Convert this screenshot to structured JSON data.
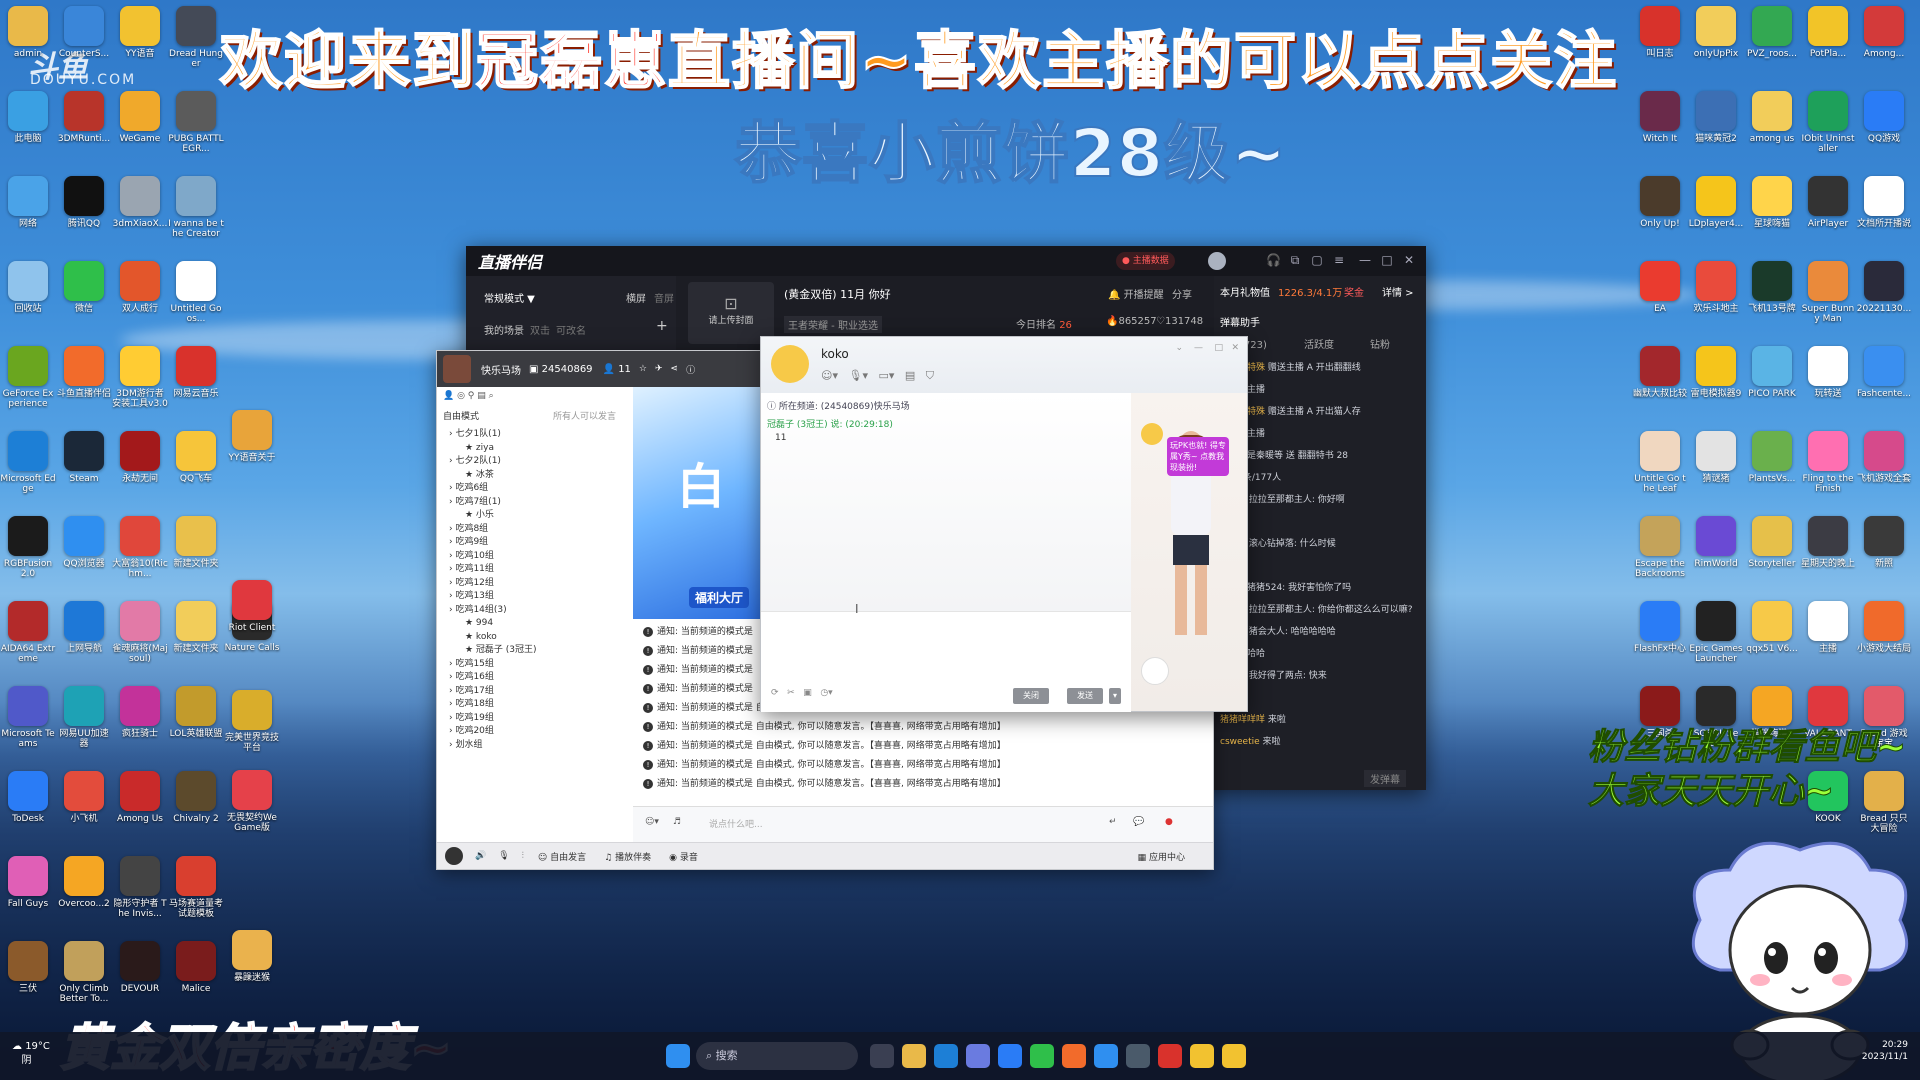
{
  "overlay": {
    "banner_welcome_a": "欢迎来到",
    "banner_welcome_name": "冠磊崽",
    "banner_welcome_b": "直播间~喜欢主播的可以点点关注",
    "banner_congrats": "恭喜小煎饼28级~",
    "banner_gold": "黄金双倍亲密度~",
    "banner_fans_1": "粉丝钻粉群看鱼吧~",
    "banner_fans_2": "大家天天开心~",
    "douyu_logo": "斗鱼",
    "douyu_sub": "DOUYU.COM"
  },
  "desktop_left": [
    {
      "label": "admin",
      "color": "#e9b949"
    },
    {
      "label": "CounterS...",
      "color": "#3a86d9"
    },
    {
      "label": "YY语音",
      "color": "#f2c230"
    },
    {
      "label": "Dread Hunger",
      "color": "#444a57"
    },
    {
      "label": "此电脑",
      "color": "#3aa0e3"
    },
    {
      "label": "3DMRunti...",
      "color": "#b8342a"
    },
    {
      "label": "WeGame",
      "color": "#f0a92b"
    },
    {
      "label": "PUBG BATTLEGR...",
      "color": "#5b5b5b"
    },
    {
      "label": "网络",
      "color": "#4aa3e8"
    },
    {
      "label": "腾讯QQ",
      "color": "#111111"
    },
    {
      "label": "3dmXiaoX...",
      "color": "#9aa5b1"
    },
    {
      "label": "I wanna be the Creator",
      "color": "#7fa8c9"
    },
    {
      "label": "回收站",
      "color": "#8fc3ec"
    },
    {
      "label": "微信",
      "color": "#2fbf4a"
    },
    {
      "label": "双人成行",
      "color": "#e3562b"
    },
    {
      "label": "Untitled Goos...",
      "color": "#ffffff"
    },
    {
      "label": "GeForce Experience",
      "color": "#6aa61f"
    },
    {
      "label": "斗鱼直播伴侣",
      "color": "#f26b2b"
    },
    {
      "label": "3DM游行者安装工具v3.0",
      "color": "#ffcc33"
    },
    {
      "label": "网易云音乐",
      "color": "#d9322c"
    },
    {
      "label": "Microsoft Edge",
      "color": "#1d7fd6"
    },
    {
      "label": "Steam",
      "color": "#1b2838"
    },
    {
      "label": "永劫无间",
      "color": "#a3191b"
    },
    {
      "label": "QQ飞车",
      "color": "#f6c53a"
    },
    {
      "label": "RGBFusion 2.0",
      "color": "#1b1b1b"
    },
    {
      "label": "QQ浏览器",
      "color": "#2f8ff0"
    },
    {
      "label": "大富翁10(Richm...",
      "color": "#e0473b"
    },
    {
      "label": "新建文件夹",
      "color": "#e9c04b"
    },
    {
      "label": "AIDA64 Extreme",
      "color": "#b32a2a"
    },
    {
      "label": "上网导航",
      "color": "#1e78d7"
    },
    {
      "label": "雀魂麻将(Majsoul)",
      "color": "#e27aa7"
    },
    {
      "label": "新建文件夹",
      "color": "#f2cd5a"
    },
    {
      "label": "Microsoft Teams",
      "color": "#5059c9"
    },
    {
      "label": "网易UU加速器",
      "color": "#1ea2b5"
    },
    {
      "label": "疯狂骑士",
      "color": "#c3329a"
    },
    {
      "label": "LOL英雄联盟",
      "color": "#c29b2c"
    },
    {
      "label": "ToDesk",
      "color": "#2a7cf6"
    },
    {
      "label": "小飞机",
      "color": "#e34c3c"
    },
    {
      "label": "Among Us",
      "color": "#c92a2a"
    },
    {
      "label": "Chivalry 2",
      "color": "#5c4a2c"
    },
    {
      "label": "Fall Guys",
      "color": "#e05fb6"
    },
    {
      "label": "Overcoo...2",
      "color": "#f5a623"
    },
    {
      "label": "隐形守护者 The Invis...",
      "color": "#444444"
    },
    {
      "label": "马场赛道量考试题模板",
      "color": "#d93f2f"
    },
    {
      "label": "三伏",
      "color": "#8b5a2b"
    },
    {
      "label": "Only Climb Better To...",
      "color": "#c1a05b"
    },
    {
      "label": "DEVOUR",
      "color": "#2a1a1a"
    },
    {
      "label": "Malice",
      "color": "#7a1c1c"
    }
  ],
  "desktop_left_extra": [
    {
      "label": "无畏契约WeGame版",
      "color": "#e5414a"
    },
    {
      "label": "完美世界竞技平台",
      "color": "#d9ad2b"
    },
    {
      "label": "Nature Calls",
      "color": "#2a2a2a"
    },
    {
      "label": "YY语音关于",
      "color": "#e8a43a"
    },
    {
      "label": "暴躁迷猴",
      "color": "#eab24d"
    },
    {
      "label": "Riot Client",
      "color": "#e0383e"
    }
  ],
  "desktop_right": [
    {
      "label": "Among...",
      "color": "#d33a3a"
    },
    {
      "label": "PotPla...",
      "color": "#f2c428"
    },
    {
      "label": "PVZ_roos...",
      "color": "#33a852"
    },
    {
      "label": "onlyUpPix",
      "color": "#f2cd5a"
    },
    {
      "label": "叫日志",
      "color": "#d8322b"
    },
    {
      "label": "QQ游戏",
      "color": "#2a7cf6"
    },
    {
      "label": "IObit Uninstaller",
      "color": "#1ea05a"
    },
    {
      "label": "among us",
      "color": "#f2cd5a"
    },
    {
      "label": "猫咪黄冠2",
      "color": "#3c6fb4"
    },
    {
      "label": "Witch It",
      "color": "#6a2a4a"
    },
    {
      "label": "文档所开播说",
      "color": "#ffffff"
    },
    {
      "label": "AirPlayer",
      "color": "#333333"
    },
    {
      "label": "星球嗨猫",
      "color": "#ffd44a"
    },
    {
      "label": "LDplayer4...",
      "color": "#f5c51b"
    },
    {
      "label": "Only Up!",
      "color": "#4b3b2b"
    },
    {
      "label": "20221130...",
      "color": "#2a2a3a"
    },
    {
      "label": "Super Bunny Man",
      "color": "#ea8a3b"
    },
    {
      "label": "飞机13号牌",
      "color": "#1a3a2a"
    },
    {
      "label": "欢乐斗地主",
      "color": "#e94b3c"
    },
    {
      "label": "EA",
      "color": "#ea3b2f"
    },
    {
      "label": "Fashcente...",
      "color": "#3a8ff0"
    },
    {
      "label": "玩转送",
      "color": "#ffffff"
    },
    {
      "label": "PICO PARK",
      "color": "#5ab4e5"
    },
    {
      "label": "雷电模拟器9",
      "color": "#f5c51b"
    },
    {
      "label": "幽默大叔比较",
      "color": "#a3272c"
    },
    {
      "label": "飞机游戏全套",
      "color": "#d64a8b"
    },
    {
      "label": "Fling to the Finish",
      "color": "#ff6fb1"
    },
    {
      "label": "PlantsVs...",
      "color": "#6ab04c"
    },
    {
      "label": "猜谜猪",
      "color": "#e3e3e3"
    },
    {
      "label": "Untitle Go the Leaf",
      "color": "#f0d7c0"
    },
    {
      "label": "新照",
      "color": "#3a3a3a"
    },
    {
      "label": "星期天的晚上",
      "color": "#3c3c44"
    },
    {
      "label": "Storyteller",
      "color": "#e6c04a"
    },
    {
      "label": "RimWorld",
      "color": "#6a4ad4"
    },
    {
      "label": "Escape the Backrooms",
      "color": "#c4a35a"
    },
    {
      "label": "小游戏大结局",
      "color": "#f06a2b"
    },
    {
      "label": "主播",
      "color": "#ffffff"
    },
    {
      "label": "qqx51 V6...",
      "color": "#f7c948"
    },
    {
      "label": "Epic Games Launcher",
      "color": "#222222"
    },
    {
      "label": "FlashFx中心",
      "color": "#2a7cf6"
    },
    {
      "label": "Bread 游戏宝宝",
      "color": "#e35a6a"
    },
    {
      "label": "VALORANT",
      "color": "#e0383e"
    },
    {
      "label": "猫咪嗨猫2",
      "color": "#f5a623"
    },
    {
      "label": "SGSOL Set...",
      "color": "#2a2a2a"
    },
    {
      "label": "三国杀",
      "color": "#8b1a1a"
    },
    {
      "label": "Bread 只只大冒险",
      "color": "#e3b04a"
    },
    {
      "label": "KOOK",
      "color": "#22c55e"
    }
  ],
  "live_companion": {
    "logo": "直播伴侣",
    "live_data_btn": "主播数据",
    "mode_label": "常规模式 ▼",
    "tab_switch": "横屏",
    "tab_audio": "音屏",
    "scene_label": "我的场景",
    "scene_a": "双击",
    "scene_b": "可改名",
    "add_icon": "+",
    "upload_cover": "请上传封面",
    "room_title": "(黄金双倍) 11月 你好",
    "room_tag": "王者荣耀 - 职业选选",
    "start_remind": "开播提醒",
    "share": "分享",
    "today_rank_label": "今日排名",
    "today_rank": "26",
    "hot": "865257",
    "followers": "131748",
    "month_gift_label": "本月礼物值",
    "month_gift_value": "1226.3/4.1万",
    "prize_label": "奖金",
    "details": "详情 >",
    "assistant": "弹幕助手",
    "user_count": "用户(723)",
    "tab_activity": "活跃度",
    "tab_diamond": "钻粉",
    "chat": [
      {
        "name": "女人类特殊",
        "text": "赠送主播 A 开出翻翻线"
      },
      {
        "name": "",
        "text": "送给了主播"
      },
      {
        "name": "女人类特殊",
        "text": "赠送主播 A 开出猫人存"
      },
      {
        "name": "",
        "text": "送给了主播"
      },
      {
        "name": "",
        "text": "一定都是秦暖等 送 翻翻特书 28"
      },
      {
        "name": "",
        "text": "1388条/177人"
      },
      {
        "name": "7.17",
        "text": "拉拉至那都主人: 你好啊"
      },
      {
        "name": "",
        "text": "不是的"
      },
      {
        "name": "7.26",
        "text": "滚心钻掉落: 什么时候"
      },
      {
        "name": "",
        "text": "上学"
      },
      {
        "name": "",
        "text": "猪猪猪猪猪524: 我好害怕你了吗"
      },
      {
        "name": "7.17",
        "text": "拉拉至那都主人: 你给你都这么么可以嘛?"
      },
      {
        "name": "7.26",
        "text": "猪会大人: 哈哈哈哈哈"
      },
      {
        "name": "",
        "text": "哈哈哈哈哈"
      },
      {
        "name": "7.17",
        "text": "我好得了两点: 快来"
      },
      {
        "name": "",
        "text": "26:29"
      },
      {
        "name": "猪猪咩咩咩",
        "text": "来啦"
      },
      {
        "name": "csweetie",
        "text": "来啦"
      }
    ],
    "send_box": "发弹幕"
  },
  "group_window": {
    "channel_name": "快乐马场",
    "channel_id": "24540869",
    "member_count": "11",
    "free_mode": "自由模式",
    "free_mode_hint": "所有人可以发言",
    "tree": [
      {
        "label": "七夕1队(1)",
        "indent": 1
      },
      {
        "label": "ziya",
        "indent": 2
      },
      {
        "label": "七夕2队(1)",
        "indent": 1
      },
      {
        "label": "冰茶",
        "indent": 2
      },
      {
        "label": "吃鸡6组",
        "indent": 1
      },
      {
        "label": "吃鸡7组(1)",
        "indent": 1
      },
      {
        "label": "小乐",
        "indent": 2
      },
      {
        "label": "吃鸡8组",
        "indent": 1
      },
      {
        "label": "吃鸡9组",
        "indent": 1
      },
      {
        "label": "吃鸡10组",
        "indent": 1
      },
      {
        "label": "吃鸡11组",
        "indent": 1
      },
      {
        "label": "吃鸡12组",
        "indent": 1
      },
      {
        "label": "吃鸡13组",
        "indent": 1
      },
      {
        "label": "吃鸡14组(3)",
        "indent": 1
      },
      {
        "label": "994",
        "indent": 2
      },
      {
        "label": "koko",
        "indent": 2
      },
      {
        "label": "冠磊子 (3冠王)",
        "indent": 2
      },
      {
        "label": "吃鸡15组",
        "indent": 1
      },
      {
        "label": "吃鸡16组",
        "indent": 1
      },
      {
        "label": "吃鸡17组",
        "indent": 1
      },
      {
        "label": "吃鸡18组",
        "indent": 1
      },
      {
        "label": "吃鸡19组",
        "indent": 1
      },
      {
        "label": "吃鸡20组",
        "indent": 1
      },
      {
        "label": "划水组",
        "indent": 1
      }
    ],
    "banner_text": "福利大厅",
    "notice_short": "通知: 当前频道的模式是",
    "notice_full": "通知: 当前频道的模式是 自由模式, 你可以随意发言。【喜喜喜, 网络带宽占用略有增加】",
    "input_placeholder": "说点什么吧...",
    "bottom_free_speech": "自由发言",
    "bottom_music": "播放伴奏",
    "bottom_record": "录音",
    "bottom_apps": "应用中心"
  },
  "pm_window": {
    "title": "koko",
    "channel_line": "所在频道: (24540869)快乐马场",
    "sender": "冠磊子 (3冠王)",
    "sender_time": "说: (20:29:18)",
    "message": "11",
    "btn_close": "关闭",
    "btn_send": "发送",
    "pk_bubble": "玩PK也就! 得专属Y秀~ 点教我现装扮!"
  },
  "taskbar": {
    "weather_temp": "19°C",
    "weather_desc": "阴",
    "search_placeholder": "搜索",
    "time": "20:29",
    "date": "2023/11/1"
  }
}
